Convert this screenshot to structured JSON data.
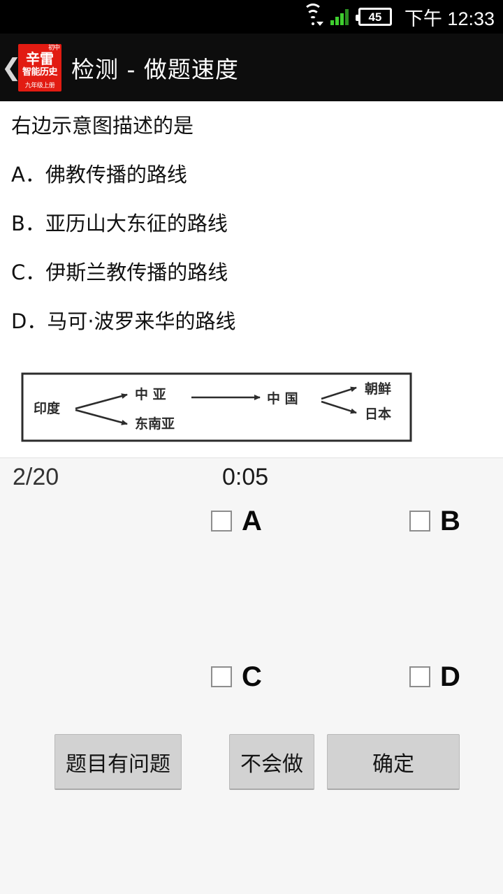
{
  "statusbar": {
    "wifi_icon": "wifi-icon",
    "signal_icon": "signal-bars-icon",
    "battery_icon": "battery-icon",
    "battery_level": "45",
    "clock": "下午 12:33"
  },
  "titlebar": {
    "back_icon": "❮",
    "logo": {
      "top": "初中",
      "main": "辛雷",
      "sub": "智能历史",
      "foot": "九年级上册"
    },
    "title": "检测 - 做题速度"
  },
  "question": {
    "stem": "右边示意图描述的是",
    "options": [
      "A．佛教传播的路线",
      "B．亚历山大东征的路线",
      "C．伊斯兰教传播的路线",
      "D．马可·波罗来华的路线"
    ]
  },
  "diagram": {
    "nodes": {
      "india": "印度",
      "central_asia": "中  亚",
      "southeast_asia": "东南亚",
      "china": "中 国",
      "korea": "朝鲜",
      "japan": "日本"
    },
    "edges": [
      "印度 → 中  亚",
      "印度 → 东南亚",
      "中  亚 → 中 国",
      "中 国 → 朝鲜",
      "中 国 → 日本"
    ]
  },
  "answer_panel": {
    "progress": "2/20",
    "timer": "0:05",
    "choices": [
      {
        "label": "A",
        "checked": false
      },
      {
        "label": "B",
        "checked": false
      },
      {
        "label": "C",
        "checked": false
      },
      {
        "label": "D",
        "checked": false
      }
    ],
    "buttons": {
      "report": "题目有问题",
      "dont_know": "不会做",
      "confirm": "确定"
    }
  },
  "colors": {
    "statusbar_bg": "#000000",
    "titlebar_bg": "#0d0d0d",
    "logo_red": "#e21b12",
    "signal_green": "#3fcf2f",
    "panel_bg": "#f6f6f6",
    "button_bg": "#d2d2d2"
  }
}
